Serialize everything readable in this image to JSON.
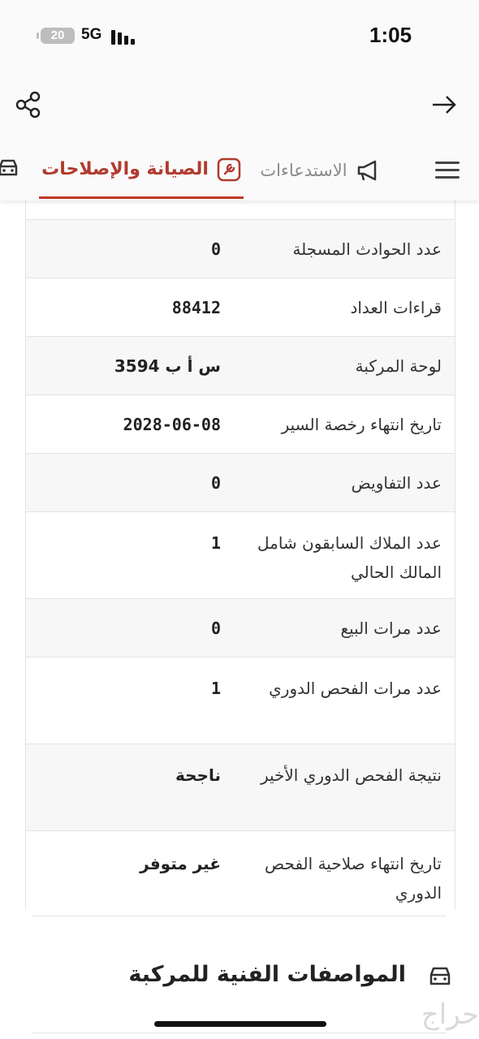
{
  "status_bar": {
    "battery": "20",
    "network": "5G",
    "time": "1:05"
  },
  "tabs": {
    "maintenance": "الصيانة والإصلاحات",
    "recalls": "الاستدعاءات"
  },
  "rows": [
    {
      "label": "عدد الحوادث المسجلة",
      "value": "0"
    },
    {
      "label": "قراءات العداد",
      "value": "88412"
    },
    {
      "label": "لوحة المركبة",
      "value": "س أ ب 3594"
    },
    {
      "label": "تاريخ انتهاء رخصة السير",
      "value": "2028-06-08"
    },
    {
      "label": "عدد التفاويض",
      "value": "0"
    },
    {
      "label": "عدد الملاك السابقون شامل المالك الحالي",
      "value": "1"
    },
    {
      "label": "عدد مرات البيع",
      "value": "0"
    },
    {
      "label": "عدد مرات الفحص الدوري",
      "value": "1"
    },
    {
      "label": "نتيجة الفحص الدوري الأخير",
      "value": "ناجحة"
    },
    {
      "label": "تاريخ انتهاء صلاحية الفحص الدوري",
      "value": "غير متوفر"
    }
  ],
  "specs_title": "المواصفات الفنية للمركبة",
  "watermark": "حراج",
  "colors": {
    "accent": "#b03a2e",
    "row_alt": "#f7f7f7"
  }
}
